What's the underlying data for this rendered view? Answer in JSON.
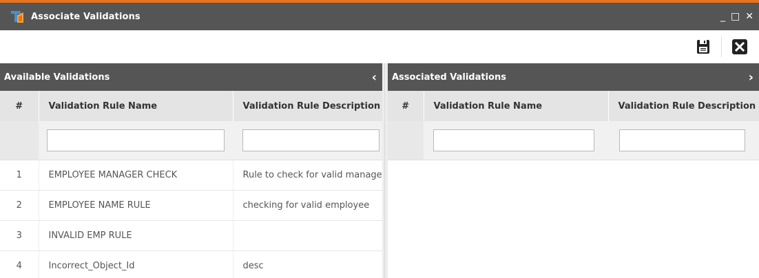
{
  "window": {
    "title": "Associate Validations",
    "controls": {
      "minimize": "_",
      "maximize": "□",
      "close": "✕"
    }
  },
  "toolbar": {
    "save_icon": "save-icon",
    "close_icon": "close-box-icon"
  },
  "available": {
    "title": "Available Validations",
    "columns": [
      "#",
      "Validation Rule Name",
      "Validation Rule Description"
    ],
    "rows": [
      {
        "num": "1",
        "name": "EMPLOYEE MANAGER CHECK",
        "desc": "Rule to check for valid manager"
      },
      {
        "num": "2",
        "name": "EMPLOYEE NAME RULE",
        "desc": "checking for valid employee"
      },
      {
        "num": "3",
        "name": "INVALID EMP RULE",
        "desc": ""
      },
      {
        "num": "4",
        "name": "Incorrect_Object_Id",
        "desc": "desc"
      }
    ]
  },
  "associated": {
    "title": "Associated Validations",
    "columns": [
      "#",
      "Validation Rule Name",
      "Validation Rule Description"
    ],
    "rows": []
  },
  "colors": {
    "header": "#555555",
    "accent": "#e8731c",
    "column_header": "#e4e4e4"
  }
}
